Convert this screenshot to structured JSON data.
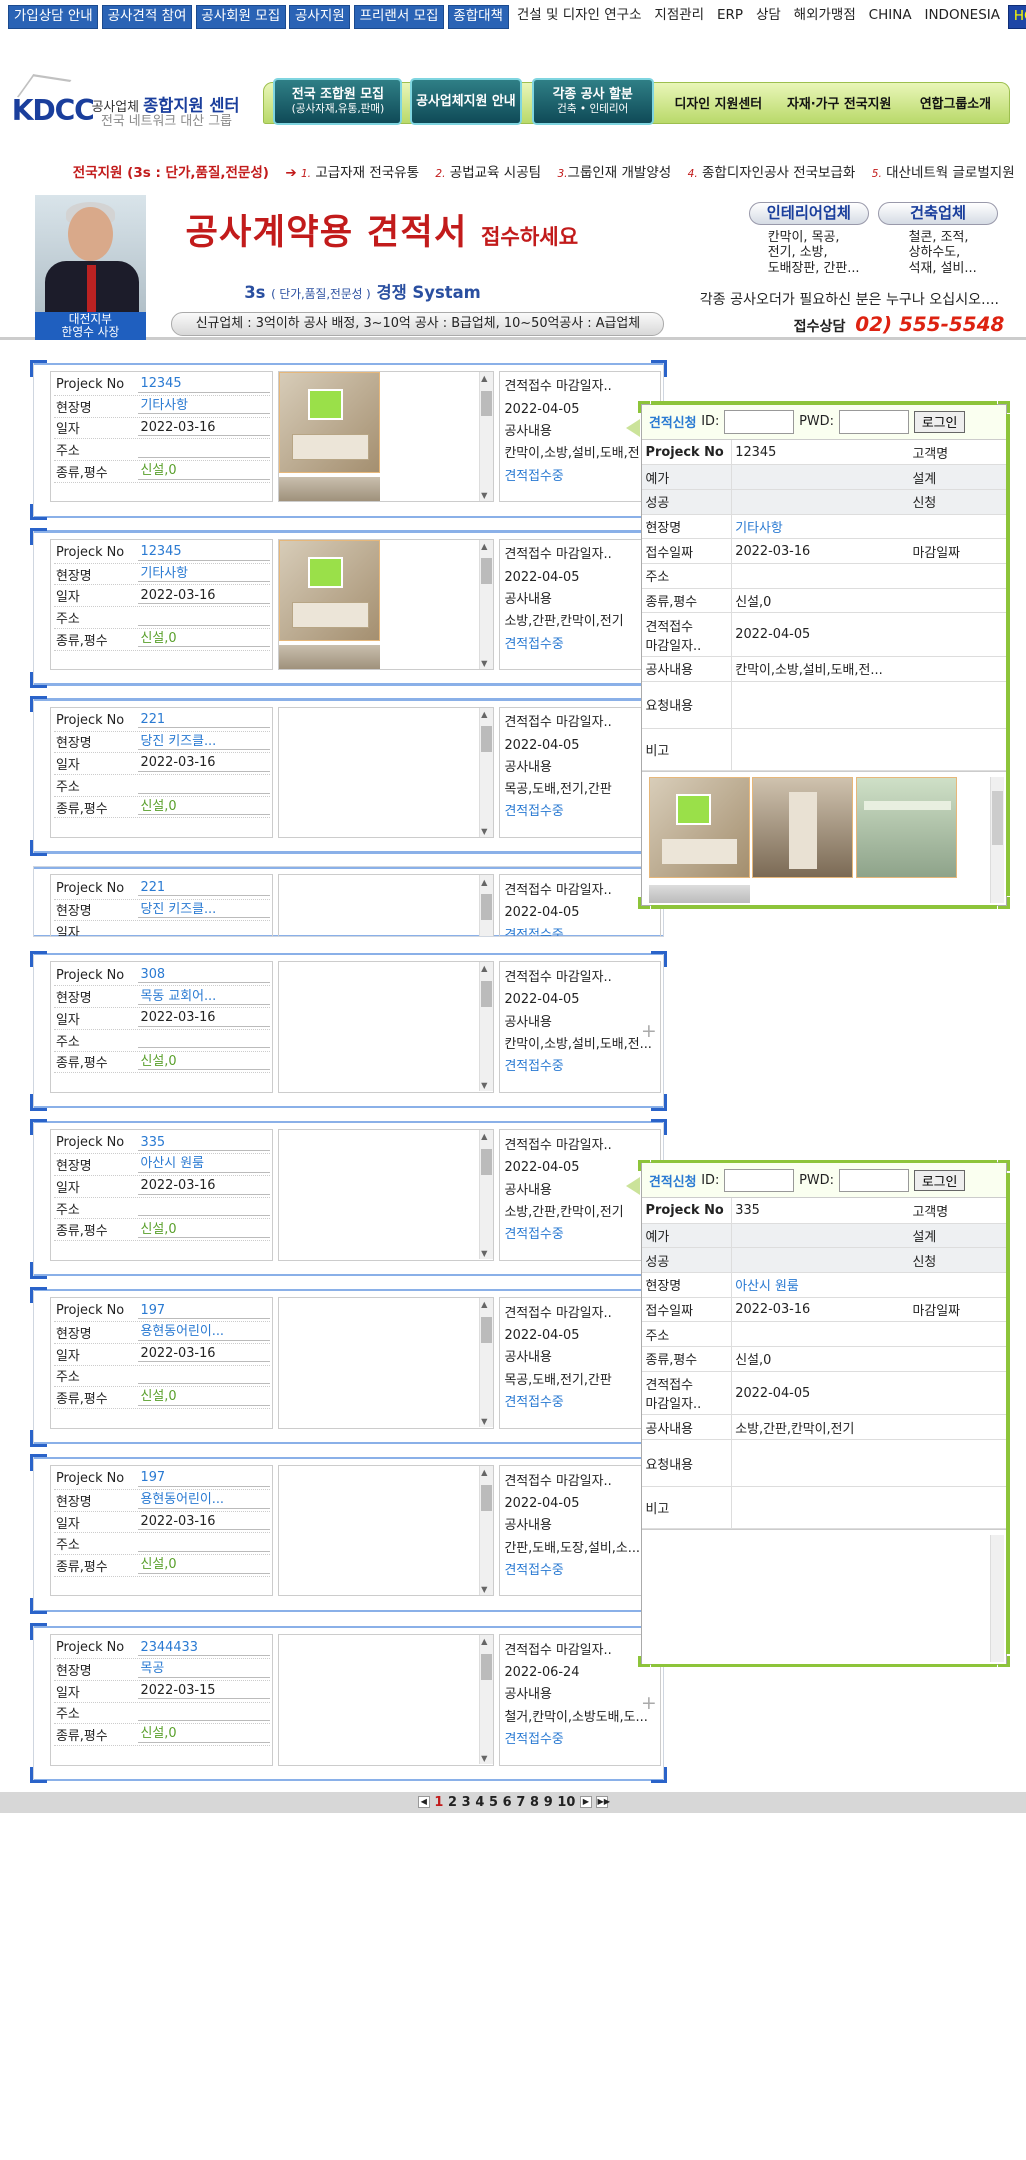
{
  "topnav": [
    "가입상담 안내",
    "공사견적 참여",
    "공사회원 모집",
    "공사지원",
    "프리랜서 모집",
    "종합대책",
    "건설 및 디자인 연구소",
    "지점관리",
    "ERP",
    "상담",
    "해외가맹점",
    "CHINA",
    "INDONESIA",
    "HOME"
  ],
  "logo": {
    "mark": "KDCC",
    "line1a": "공사업체",
    "line1b": "종합지원 센터",
    "line2": "전국 네트워크 대산 그룹"
  },
  "mainnav": {
    "tab1a": "전국 조합원 모집",
    "tab1b": "(공사자재,유통,판매)",
    "tab2": "공사업체지원 안내",
    "tab3a": "각종 공사 할분",
    "tab3b": "건축 • 인테리어",
    "tab4": "디자인 지원센터",
    "tab5": "자재·가구 전국지원",
    "tab6": "연합그룹소개"
  },
  "subline": {
    "lead": "전국지원 (3s : 단가,품질,전문성)",
    "i1": "1.",
    "t1": "고급자재 전국유통",
    "i2": "2.",
    "t2": "공법교육 시공팀",
    "i3": "3.",
    "t3": "그룹인재 개발양성",
    "i4": "4.",
    "t4": "종합디자인공사 전국보급화",
    "i5": "5.",
    "t5": "대산네트웍 글로벌지원"
  },
  "hero": {
    "caption1": "대전지부",
    "caption2": "한영수 사장",
    "headline": "공사계약용 견적서",
    "headline_small": "접수하세요",
    "systam_a": "3s",
    "systam_b": "( 단가,품질,전문성 )",
    "systam_c": "경쟁 Systam",
    "pill": "신규업체 : 3억이하 공사 배정,    3~10억 공사 : B급업체,    10~50억공사 : A급업체",
    "cat1": "인테리어업체",
    "cat1list": "칸막이, 목공,\n전기, 소방,\n도배장판, 간판...",
    "cat2": "건축업체",
    "cat2list": "철콘, 조적,\n상하수도,\n석재, 설비...",
    "wish": "각종 공사오더가 필요하신 분은 누구나 오십시오....",
    "consult": "접수상담",
    "tel": "02) 555-5548"
  },
  "labels": {
    "proj": "Projeck No",
    "site": "현장명",
    "date": "일자",
    "addr": "주소",
    "kind": "종류,평수",
    "det1": "견적접수 마감일자..",
    "det3": "공사내용",
    "det5": "견적접수중"
  },
  "cards": [
    {
      "no": "12345",
      "site": "기타사항",
      "date": "2022-03-16",
      "kind": "신설,0",
      "deadline": "2022-04-05",
      "work": "칸막이,소방,설비,도배,전...",
      "img": true
    },
    {
      "no": "12345",
      "site": "기타사항",
      "date": "2022-03-16",
      "kind": "신설,0",
      "deadline": "2022-04-05",
      "work": "소방,간판,칸막이,전기",
      "img": true
    },
    {
      "no": "221",
      "site": "당진 키즈클...",
      "date": "2022-03-16",
      "kind": "신설,0",
      "deadline": "2022-04-05",
      "work": "목공,도배,전기,간판",
      "img": false
    },
    {
      "no": "221",
      "site": "당진 키즈클...",
      "date": "",
      "kind": "",
      "deadline": "2022-04-05",
      "work": "",
      "img": false
    },
    {
      "no": "308",
      "site": "목동 교회어...",
      "date": "2022-03-16",
      "kind": "신설,0",
      "deadline": "2022-04-05",
      "work": "칸막이,소방,설비,도배,전...",
      "img": false
    },
    {
      "no": "335",
      "site": "아산시 원룸",
      "date": "2022-03-16",
      "kind": "신설,0",
      "deadline": "2022-04-05",
      "work": "소방,간판,칸막이,전기",
      "img": false
    },
    {
      "no": "197",
      "site": "용현동어린이...",
      "date": "2022-03-16",
      "kind": "신설,0",
      "deadline": "2022-04-05",
      "work": "목공,도배,전기,간판",
      "img": false
    },
    {
      "no": "197",
      "site": "용현동어린이...",
      "date": "2022-03-16",
      "kind": "신설,0",
      "deadline": "2022-04-05",
      "work": "간판,도배,도장,설비,소...",
      "img": false
    },
    {
      "no": "2344433",
      "site": "목공",
      "date": "2022-03-15",
      "kind": "신설,0",
      "deadline": "2022-06-24",
      "work": "철거,칸막이,소방도배,도...",
      "img": false
    }
  ],
  "popup": {
    "apply": "견적신청",
    "id": "ID:",
    "pwd": "PWD:",
    "login": "로그인",
    "k_proj": "Projeck No",
    "k_client": "고객명",
    "k_est": "예가",
    "k_design": "설계",
    "k_ok": "성공",
    "k_apply": "신청",
    "k_site": "현장명",
    "k_recv": "접수일짜",
    "k_close": "마감일짜",
    "k_addr": "주소",
    "k_kind": "종류,평수",
    "k_dead": "견적접수\n마감일자..",
    "k_work": "공사내용",
    "k_req": "요청내용",
    "k_note": "비고"
  },
  "popups": [
    {
      "no": "12345",
      "site": "기타사항",
      "recv": "2022-03-16",
      "kind": "신설,0",
      "dead": "2022-04-05",
      "work": "칸막이,소방,설비,도배,전..."
    },
    {
      "no": "335",
      "site": "아산시 원룸",
      "recv": "2022-03-16",
      "kind": "신설,0",
      "dead": "2022-04-05",
      "work": "소방,간판,칸막이,전기"
    }
  ],
  "pager": {
    "pages": [
      "1",
      "2",
      "3",
      "4",
      "5",
      "6",
      "7",
      "8",
      "9",
      "10"
    ],
    "current": "1"
  },
  "colors": {
    "accent_blue": "#2a63b5",
    "accent_red": "#c21b1b",
    "accent_green": "#8dc43a"
  }
}
